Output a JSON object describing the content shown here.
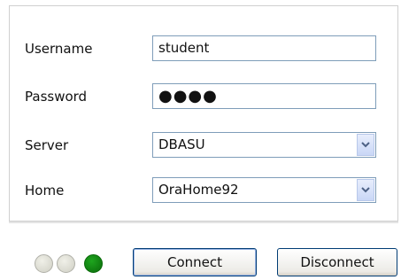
{
  "form": {
    "username_label": "Username",
    "username_value": "student",
    "password_label": "Password",
    "password_mask": "●●●●",
    "server_label": "Server",
    "server_value": "DBASU",
    "home_label": "Home",
    "home_value": "OraHome92"
  },
  "status_lights": [
    {
      "state": "off",
      "color": "#d8d8cc"
    },
    {
      "state": "off",
      "color": "#d8d8cc"
    },
    {
      "state": "on",
      "color": "#138a13"
    }
  ],
  "buttons": {
    "connect_label": "Connect",
    "disconnect_label": "Disconnect"
  }
}
